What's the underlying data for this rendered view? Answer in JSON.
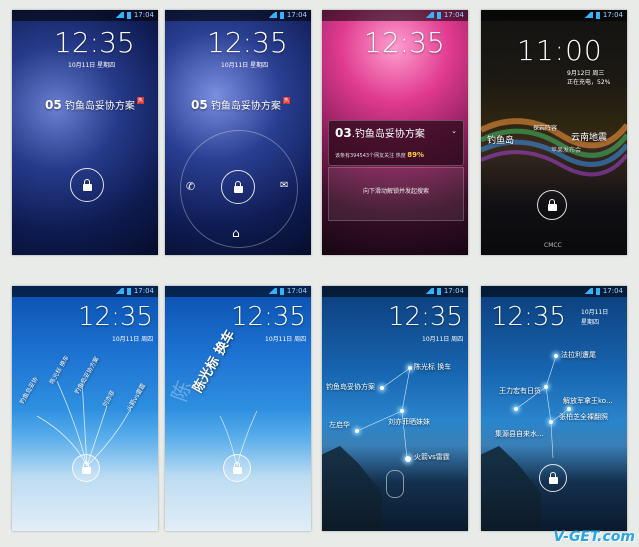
{
  "screens": [
    {
      "status_time": "17:04",
      "clock": "12:35",
      "date": "10月11日 星期四",
      "headline_num": "05",
      "headline_text": "钓鱼岛妥协方案",
      "badge": "热"
    },
    {
      "status_time": "17:04",
      "clock": "12:35",
      "date": "10月11日 星期四",
      "headline_num": "05",
      "headline_text": "钓鱼岛妥协方案",
      "badge": "热"
    },
    {
      "status_time": "17:04",
      "clock": "12:35",
      "card_num": "03",
      "card_title": "钓鱼岛妥协方案",
      "card_stats": "该条有394543个网友关注",
      "heat_label": "热度",
      "heat_value": "89%",
      "slide_hint": "向下滑动解锁并发起搜索"
    },
    {
      "status_time": "17:04",
      "clock": "11:00",
      "date": "9月12日 周三",
      "charging": "正在充电，52%",
      "tags": [
        "钓鱼岛",
        "探岩阵容",
        "云南地震",
        "苹果发布会"
      ],
      "carrier": "CMCC"
    },
    {
      "status_time": "17:04",
      "clock": "12:35",
      "date": "10月11日 周四",
      "branches": [
        "钓鱼岛妥协",
        "陈光标 换车",
        "钓鱼岛妥协方案",
        "刘亦菲",
        "火箭vs雷霆"
      ]
    },
    {
      "status_time": "17:04",
      "clock": "12:35",
      "date": "10月11日 周四",
      "big_word": "陈光标 换车",
      "ghost_word": "陈"
    },
    {
      "status_time": "17:04",
      "clock": "12:35",
      "date": "10月11日 周四",
      "nodes": [
        "陈光标 换车",
        "钓鱼岛妥协方案",
        "刘亦菲晒妹妹",
        "左启华",
        "火箭vs雷霆"
      ]
    },
    {
      "status_time": "17:04",
      "clock": "12:35",
      "date": "10月11日",
      "weekday": "星期四",
      "nodes": [
        "法拉利遭尾",
        "王力宏有日货",
        "解放军拿王ko...",
        "张柏芝全裸翻照",
        "集源县自来水..."
      ]
    }
  ],
  "watermark": "V-GET.com"
}
